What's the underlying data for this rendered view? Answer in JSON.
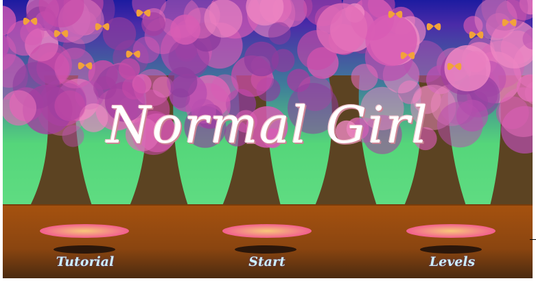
{
  "game": {
    "title": "Normal Girl"
  },
  "menu": {
    "tutorial_label": "Tutorial",
    "start_label": "Start",
    "levels_label": "Levels"
  },
  "colors": {
    "sky_top": "#1c1ba0",
    "blossom": "#c94aa8",
    "trunk": "#5c4322",
    "grass": "#55d67a",
    "ground": "#a6520f",
    "platform": "#f3709b",
    "butterfly": "#f2a23a",
    "button_text": "#cdeeff"
  }
}
